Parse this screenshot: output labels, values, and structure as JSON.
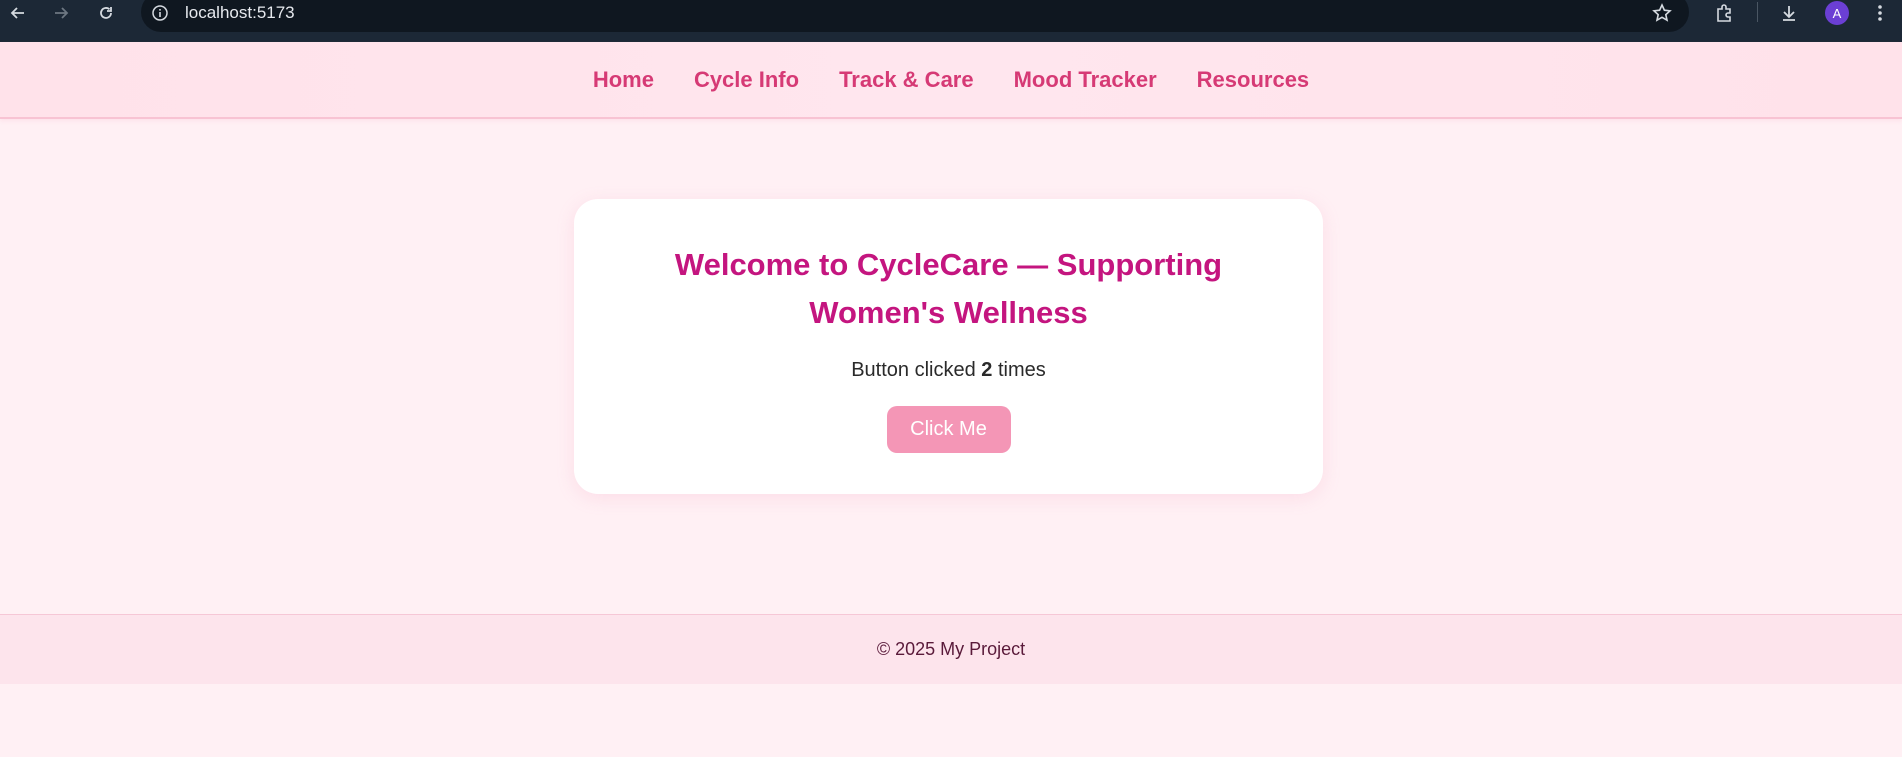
{
  "browser": {
    "url": "localhost:5173",
    "avatar_letter": "A",
    "icons": [
      "back-arrow-icon",
      "forward-arrow-icon",
      "reload-icon",
      "site-info-icon",
      "bookmark-star-icon",
      "extensions-icon",
      "download-icon",
      "menu-kebab-icon"
    ]
  },
  "nav": {
    "items": [
      {
        "label": "Home"
      },
      {
        "label": "Cycle Info"
      },
      {
        "label": "Track & Care"
      },
      {
        "label": "Mood Tracker"
      },
      {
        "label": "Resources"
      }
    ]
  },
  "card": {
    "title": "Welcome to CycleCare — Supporting Women's Wellness",
    "counter_prefix": "Button clicked",
    "counter_value": "2",
    "counter_suffix": "times",
    "button_label": "Click Me"
  },
  "footer": {
    "text": "© 2025 My Project"
  },
  "colors": {
    "accent": "#c4157f",
    "nav_link": "#d63a75",
    "button": "#f496b6",
    "page_bg": "#fff0f4"
  }
}
